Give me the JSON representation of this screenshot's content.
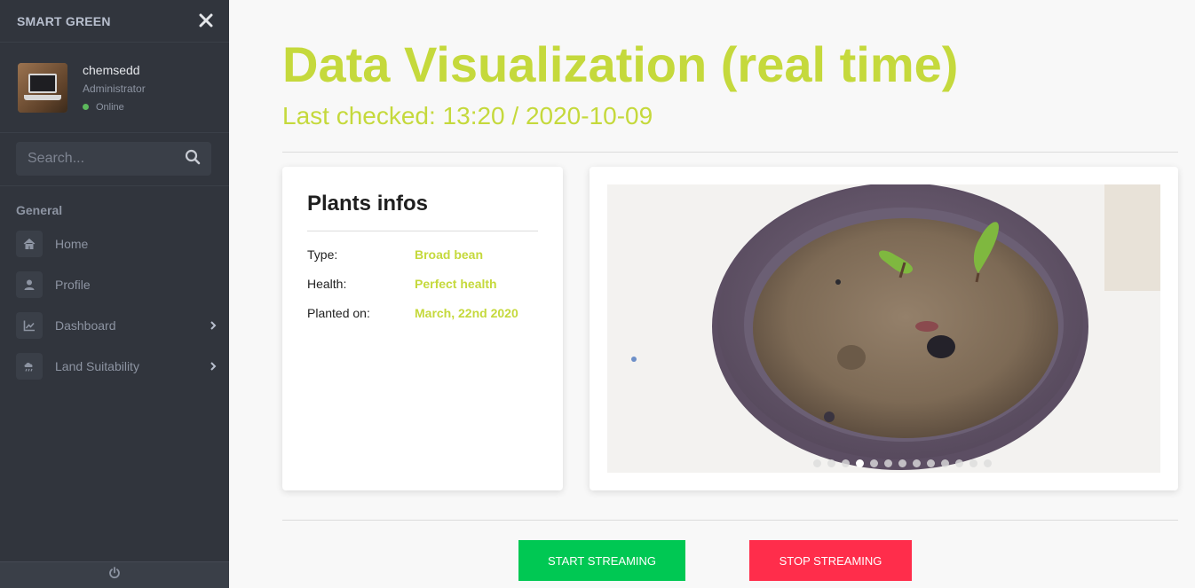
{
  "sidebar": {
    "brand": "SMART GREEN",
    "user": {
      "name": "chemsedd",
      "role": "Administrator",
      "status": "Online"
    },
    "search": {
      "placeholder": "Search..."
    },
    "section": "General",
    "items": [
      {
        "label": "Home",
        "icon": "home-icon",
        "has_submenu": false
      },
      {
        "label": "Profile",
        "icon": "user-icon",
        "has_submenu": false
      },
      {
        "label": "Dashboard",
        "icon": "chart-icon",
        "has_submenu": true
      },
      {
        "label": "Land Suitability",
        "icon": "weather-icon",
        "has_submenu": true
      }
    ],
    "footer_icon": "power-icon"
  },
  "main": {
    "title": "Data Visualization (real time)",
    "last_checked": "Last checked: 13:20 / 2020-10-09",
    "plants": {
      "heading": "Plants infos",
      "rows": [
        {
          "key": "Type:",
          "value": "Broad bean"
        },
        {
          "key": "Health:",
          "value": "Perfect health"
        },
        {
          "key": "Planted on:",
          "value": "March, 22nd 2020"
        }
      ]
    },
    "carousel": {
      "slide_count": 13,
      "active_index": 3
    },
    "buttons": {
      "start": "START STREAMING",
      "stop": "STOP STREAMING"
    }
  },
  "colors": {
    "accent": "#c5d93c",
    "sidebar_bg": "#31353d",
    "start": "#00c853",
    "stop": "#ff2d4b",
    "online": "#5cb85c"
  }
}
